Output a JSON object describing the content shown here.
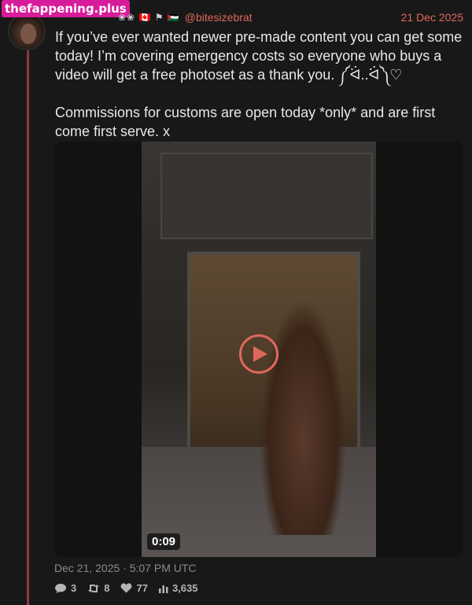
{
  "watermark": "thefappening.plus",
  "header": {
    "flags": "❀❀ 🇨🇦 ⚑ 🇵🇸",
    "handle": "@bitesizebrat",
    "date": "21 Dec 2025"
  },
  "tweet": {
    "paragraph1": "If you’ve ever wanted newer pre-made content you can get some today! I’m covering emergency costs so everyone who buys a video will get a free photoset as a thank you. ༼ᐛ..ᐛ༽♡",
    "paragraph2": "Commissions for customs are open today *only* and are first come first serve. x"
  },
  "media": {
    "duration": "0:09",
    "icon": "play-icon",
    "accent": "#e0675d"
  },
  "meta": {
    "timestamp": "Dec 21, 2025 · 5:07 PM UTC"
  },
  "stats": {
    "replies": "3",
    "retweets": "8",
    "likes": "77",
    "views": "3,635"
  }
}
